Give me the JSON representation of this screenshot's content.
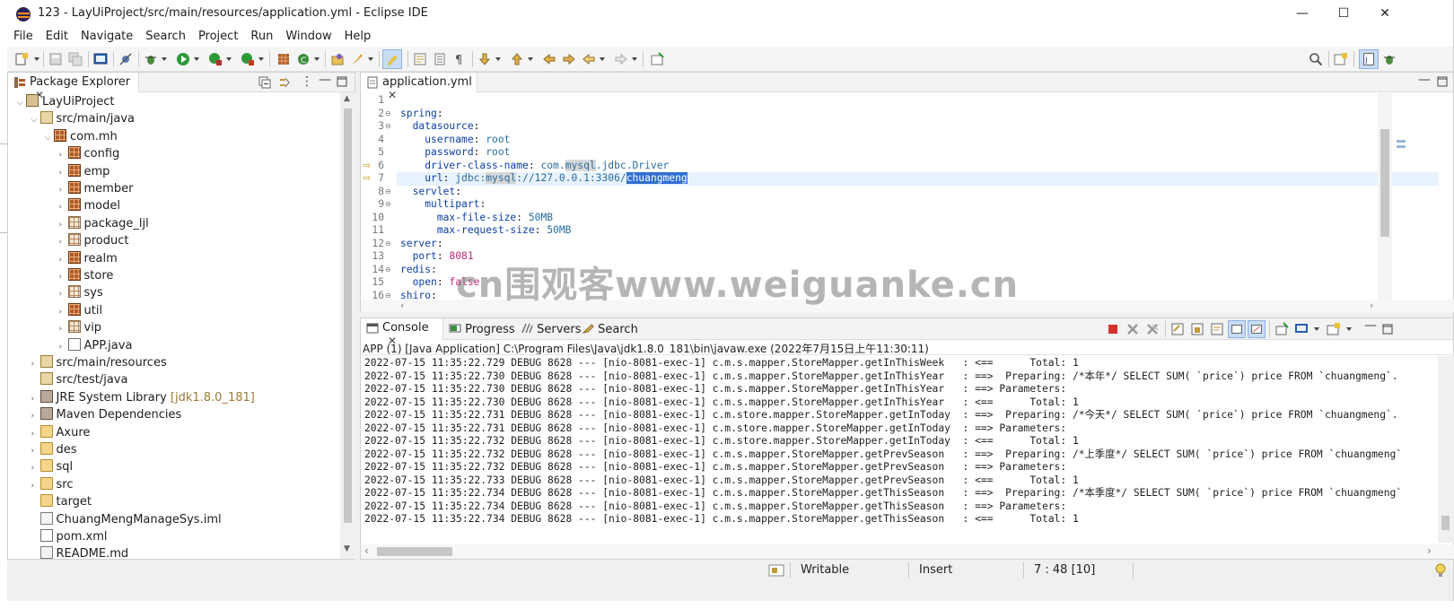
{
  "window": {
    "title": "123 - LayUiProject/src/main/resources/application.yml - Eclipse IDE",
    "minimize": "—",
    "maximize": "☐",
    "close": "✕"
  },
  "menu": [
    "File",
    "Edit",
    "Navigate",
    "Search",
    "Project",
    "Run",
    "Window",
    "Help"
  ],
  "package_explorer": {
    "tab_label": "Package Explorer",
    "tree": [
      {
        "label": "LayUiProject",
        "icon": "project-icon",
        "indent": 0,
        "twisty": "▼"
      },
      {
        "label": "src/main/java",
        "icon": "source-folder-icon",
        "indent": 1,
        "twisty": "▼"
      },
      {
        "label": "com.mh",
        "icon": "package-icon",
        "indent": 2,
        "twisty": "▼"
      },
      {
        "label": "config",
        "icon": "package-icon",
        "indent": 3,
        "twisty": "›"
      },
      {
        "label": "emp",
        "icon": "package-icon",
        "indent": 3,
        "twisty": "›"
      },
      {
        "label": "member",
        "icon": "package-icon",
        "indent": 3,
        "twisty": "›"
      },
      {
        "label": "model",
        "icon": "package-icon",
        "indent": 3,
        "twisty": "›"
      },
      {
        "label": "package_ljl",
        "icon": "empty-package-icon",
        "indent": 3,
        "twisty": "›"
      },
      {
        "label": "product",
        "icon": "empty-package-icon",
        "indent": 3,
        "twisty": "›"
      },
      {
        "label": "realm",
        "icon": "package-icon",
        "indent": 3,
        "twisty": "›"
      },
      {
        "label": "store",
        "icon": "package-icon",
        "indent": 3,
        "twisty": "›"
      },
      {
        "label": "sys",
        "icon": "empty-package-icon",
        "indent": 3,
        "twisty": "›"
      },
      {
        "label": "util",
        "icon": "package-icon",
        "indent": 3,
        "twisty": "›"
      },
      {
        "label": "vip",
        "icon": "empty-package-icon",
        "indent": 3,
        "twisty": "›"
      },
      {
        "label": "APP.java",
        "icon": "java-file-icon",
        "indent": 3,
        "twisty": "›"
      },
      {
        "label": "src/main/resources",
        "icon": "source-folder-icon",
        "indent": 1,
        "twisty": "›"
      },
      {
        "label": "src/test/java",
        "icon": "source-folder-icon",
        "indent": 1,
        "twisty": ""
      },
      {
        "label": "JRE System Library",
        "suffix": "[jdk1.8.0_181]",
        "icon": "library-icon",
        "indent": 1,
        "twisty": "›"
      },
      {
        "label": "Maven Dependencies",
        "icon": "library-icon",
        "indent": 1,
        "twisty": "›"
      },
      {
        "label": "Axure",
        "icon": "folder-icon",
        "indent": 1,
        "twisty": "›"
      },
      {
        "label": "des",
        "icon": "folder-icon",
        "indent": 1,
        "twisty": "›"
      },
      {
        "label": "sql",
        "icon": "folder-icon",
        "indent": 1,
        "twisty": "›"
      },
      {
        "label": "src",
        "icon": "folder-icon",
        "indent": 1,
        "twisty": "›"
      },
      {
        "label": "target",
        "icon": "folder-icon",
        "indent": 1,
        "twisty": ""
      },
      {
        "label": "ChuangMengManageSys.iml",
        "icon": "file-icon",
        "indent": 1,
        "twisty": ""
      },
      {
        "label": "pom.xml",
        "icon": "xml-file-icon",
        "indent": 1,
        "twisty": ""
      },
      {
        "label": "README.md",
        "icon": "md-file-icon",
        "indent": 1,
        "twisty": ""
      }
    ]
  },
  "editor": {
    "tab_label": "application.yml",
    "lines": [
      {
        "n": "1",
        "fold": "",
        "marker": "",
        "html": ""
      },
      {
        "n": "2",
        "fold": "⊖",
        "marker": "",
        "parts": [
          [
            "k-key",
            "spring"
          ],
          [
            "",
            ":"
          ]
        ]
      },
      {
        "n": "3",
        "fold": "⊖",
        "marker": "",
        "parts": [
          [
            "",
            "  "
          ],
          [
            "k-key",
            "datasource"
          ],
          [
            "",
            ":"
          ]
        ]
      },
      {
        "n": "4",
        "fold": "",
        "marker": "",
        "parts": [
          [
            "",
            "    "
          ],
          [
            "k-key",
            "username"
          ],
          [
            "",
            ": "
          ],
          [
            "k-val",
            "root"
          ]
        ]
      },
      {
        "n": "5",
        "fold": "",
        "marker": "",
        "parts": [
          [
            "",
            "    "
          ],
          [
            "k-key",
            "password"
          ],
          [
            "",
            ": "
          ],
          [
            "k-val",
            "root"
          ]
        ]
      },
      {
        "n": "6",
        "fold": "",
        "marker": "⇨",
        "parts": [
          [
            "",
            "    "
          ],
          [
            "k-key",
            "driver-class-name"
          ],
          [
            "",
            ": "
          ],
          [
            "k-val",
            "com."
          ],
          [
            "k-val hl-word",
            "mysql"
          ],
          [
            "k-val",
            ".jdbc.Driver"
          ]
        ]
      },
      {
        "n": "7",
        "fold": "",
        "marker": "⇨",
        "parts": [
          [
            "",
            "    "
          ],
          [
            "k-key",
            "url"
          ],
          [
            "",
            ": "
          ],
          [
            "k-val",
            "jdbc:"
          ],
          [
            "k-val hl-word",
            "mysql"
          ],
          [
            "k-val",
            "://127.0.0.1:3306/"
          ],
          [
            "sel",
            "chuangmeng"
          ]
        ]
      },
      {
        "n": "8",
        "fold": "⊖",
        "marker": "",
        "parts": [
          [
            "",
            "  "
          ],
          [
            "k-key",
            "servlet"
          ],
          [
            "",
            ":"
          ]
        ]
      },
      {
        "n": "9",
        "fold": "⊖",
        "marker": "",
        "parts": [
          [
            "",
            "    "
          ],
          [
            "k-key",
            "multipart"
          ],
          [
            "",
            ":"
          ]
        ]
      },
      {
        "n": "10",
        "fold": "",
        "marker": "",
        "parts": [
          [
            "",
            "      "
          ],
          [
            "k-key",
            "max-file-size"
          ],
          [
            "",
            ": "
          ],
          [
            "k-val",
            "50MB"
          ]
        ]
      },
      {
        "n": "11",
        "fold": "",
        "marker": "",
        "parts": [
          [
            "",
            "      "
          ],
          [
            "k-key",
            "max-request-size"
          ],
          [
            "",
            ": "
          ],
          [
            "k-val",
            "50MB"
          ]
        ]
      },
      {
        "n": "12",
        "fold": "⊖",
        "marker": "",
        "parts": [
          [
            "k-key",
            "server"
          ],
          [
            "",
            ":"
          ]
        ]
      },
      {
        "n": "13",
        "fold": "",
        "marker": "",
        "parts": [
          [
            "",
            "  "
          ],
          [
            "k-key",
            "port"
          ],
          [
            "",
            ": "
          ],
          [
            "k-num",
            "8081"
          ]
        ]
      },
      {
        "n": "14",
        "fold": "⊖",
        "marker": "",
        "parts": [
          [
            "k-key",
            "redis"
          ],
          [
            "",
            ":"
          ]
        ]
      },
      {
        "n": "15",
        "fold": "",
        "marker": "",
        "parts": [
          [
            "",
            "  "
          ],
          [
            "k-key",
            "open"
          ],
          [
            "",
            ": "
          ],
          [
            "k-num",
            "false"
          ]
        ]
      },
      {
        "n": "16",
        "fold": "⊖",
        "marker": "",
        "parts": [
          [
            "k-key",
            "shiro"
          ],
          [
            "",
            ":"
          ]
        ]
      }
    ]
  },
  "bottom_tabs": {
    "console": "Console",
    "progress": "Progress",
    "servers": "Servers",
    "search": "Search"
  },
  "console": {
    "header": "APP (1) [Java Application] C:\\Program Files\\Java\\jdk1.8.0_181\\bin\\javaw.exe  (2022年7月15日上午11:30:11)",
    "lines": [
      "2022-07-15 11:35:22.729 DEBUG 8628 --- [nio-8081-exec-1] c.m.s.mapper.StoreMapper.getInThisWeek   : <==      Total: 1",
      "2022-07-15 11:35:22.730 DEBUG 8628 --- [nio-8081-exec-1] c.m.s.mapper.StoreMapper.getInThisYear   : ==>  Preparing: /*本年*/ SELECT SUM( `price`) price FROM `chuangmeng`.",
      "2022-07-15 11:35:22.730 DEBUG 8628 --- [nio-8081-exec-1] c.m.s.mapper.StoreMapper.getInThisYear   : ==> Parameters: ",
      "2022-07-15 11:35:22.730 DEBUG 8628 --- [nio-8081-exec-1] c.m.s.mapper.StoreMapper.getInThisYear   : <==      Total: 1",
      "2022-07-15 11:35:22.731 DEBUG 8628 --- [nio-8081-exec-1] c.m.store.mapper.StoreMapper.getInToday  : ==>  Preparing: /*今天*/ SELECT SUM( `price`) price FROM `chuangmeng`.",
      "2022-07-15 11:35:22.731 DEBUG 8628 --- [nio-8081-exec-1] c.m.store.mapper.StoreMapper.getInToday  : ==> Parameters: ",
      "2022-07-15 11:35:22.732 DEBUG 8628 --- [nio-8081-exec-1] c.m.store.mapper.StoreMapper.getInToday  : <==      Total: 1",
      "2022-07-15 11:35:22.732 DEBUG 8628 --- [nio-8081-exec-1] c.m.s.mapper.StoreMapper.getPrevSeason   : ==>  Preparing: /*上季度*/ SELECT SUM( `price`) price FROM `chuangmeng`",
      "2022-07-15 11:35:22.732 DEBUG 8628 --- [nio-8081-exec-1] c.m.s.mapper.StoreMapper.getPrevSeason   : ==> Parameters: ",
      "2022-07-15 11:35:22.733 DEBUG 8628 --- [nio-8081-exec-1] c.m.s.mapper.StoreMapper.getPrevSeason   : <==      Total: 1",
      "2022-07-15 11:35:22.734 DEBUG 8628 --- [nio-8081-exec-1] c.m.s.mapper.StoreMapper.getThisSeason   : ==>  Preparing: /*本季度*/ SELECT SUM( `price`) price FROM `chuangmeng`",
      "2022-07-15 11:35:22.734 DEBUG 8628 --- [nio-8081-exec-1] c.m.s.mapper.StoreMapper.getThisSeason   : ==> Parameters: ",
      "2022-07-15 11:35:22.734 DEBUG 8628 --- [nio-8081-exec-1] c.m.s.mapper.StoreMapper.getThisSeason   : <==      Total: 1"
    ]
  },
  "status": {
    "writable": "Writable",
    "insert": "Insert",
    "position": "7 : 48 [10]"
  },
  "watermark": "cn围观客www.weiguanke.cn",
  "colors": {
    "selection": "#2f6fd1",
    "yaml_key": "#0d3fa3",
    "yaml_value": "#2a6e9e",
    "yaml_number": "#c32a7a",
    "current_line": "#e8f2fe"
  }
}
